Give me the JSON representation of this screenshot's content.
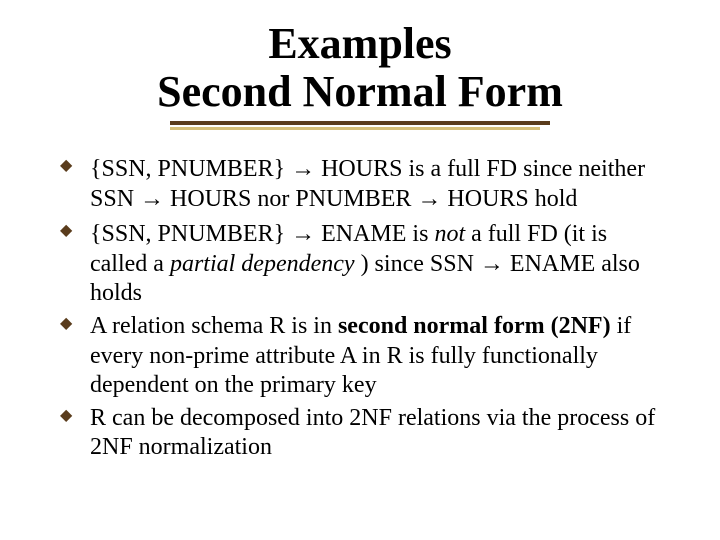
{
  "title": {
    "line1": "Examples",
    "line2": "Second Normal Form"
  },
  "arrow": "→",
  "bullets": [
    {
      "parts": [
        {
          "t": "{SSN, PNUMBER} "
        },
        {
          "t": "→",
          "cls": "arrow"
        },
        {
          "t": " HOURS is a full FD since neither SSN "
        },
        {
          "t": "→",
          "cls": "arrow"
        },
        {
          "t": " HOURS nor PNUMBER "
        },
        {
          "t": "→",
          "cls": "arrow"
        },
        {
          "t": " HOURS hold"
        }
      ]
    },
    {
      "parts": [
        {
          "t": "{SSN, PNUMBER} "
        },
        {
          "t": "→",
          "cls": "arrow"
        },
        {
          "t": " ENAME is "
        },
        {
          "t": "not",
          "tag": "i"
        },
        {
          "t": "  a full FD (it is called a "
        },
        {
          "t": "partial dependency",
          "tag": "i"
        },
        {
          "t": " ) since SSN "
        },
        {
          "t": "→",
          "cls": "arrow"
        },
        {
          "t": " ENAME also holds"
        }
      ]
    },
    {
      "parts": [
        {
          "t": "A relation schema R is in "
        },
        {
          "t": "second normal form (2NF)",
          "tag": "b"
        },
        {
          "t": " if every non-prime attribute A in R is fully functionally dependent on the primary key"
        }
      ]
    },
    {
      "parts": [
        {
          "t": "R can be decomposed into 2NF relations via the process of 2NF normalization"
        }
      ]
    }
  ]
}
